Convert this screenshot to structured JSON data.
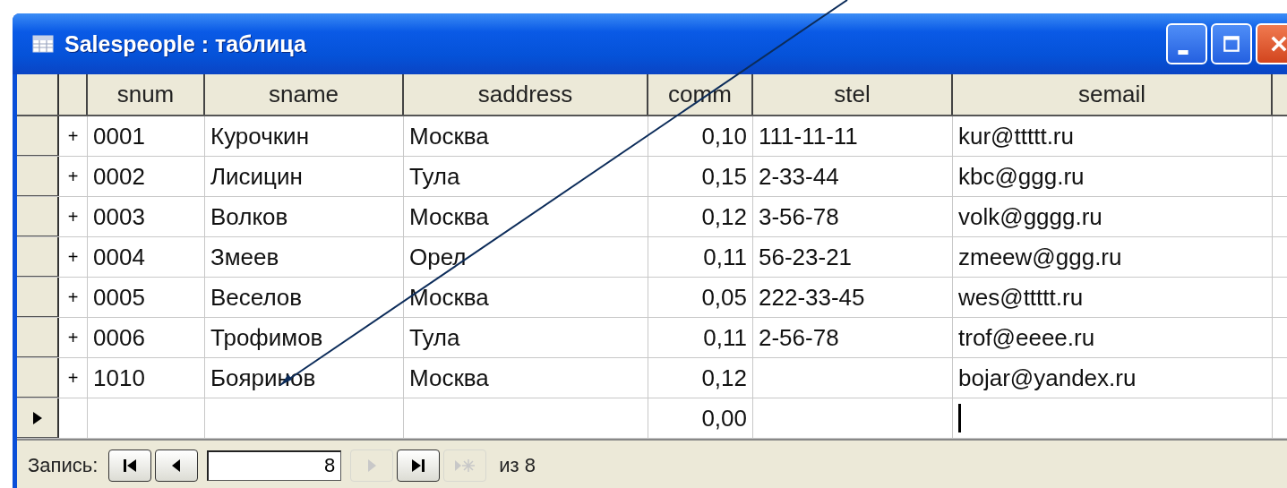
{
  "window": {
    "title": "Salespeople : таблица"
  },
  "table": {
    "columns": [
      {
        "label": "snum",
        "kind": "text"
      },
      {
        "label": "sname",
        "kind": "text"
      },
      {
        "label": "saddress",
        "kind": "text"
      },
      {
        "label": "comm",
        "kind": "number"
      },
      {
        "label": "stel",
        "kind": "text"
      },
      {
        "label": "semail",
        "kind": "text"
      }
    ],
    "rows": [
      {
        "current": false,
        "expand": "+",
        "cells": [
          "0001",
          "Курочкин",
          "Москва",
          "0,10",
          "111-11-11",
          "kur@ttttt.ru"
        ]
      },
      {
        "current": false,
        "expand": "+",
        "cells": [
          "0002",
          "Лисицин",
          "Тула",
          "0,15",
          "2-33-44",
          "kbc@ggg.ru"
        ]
      },
      {
        "current": false,
        "expand": "+",
        "cells": [
          "0003",
          "Волков",
          "Москва",
          "0,12",
          "3-56-78",
          "volk@gggg.ru"
        ]
      },
      {
        "current": false,
        "expand": "+",
        "cells": [
          "0004",
          "Змеев",
          "Орел",
          "0,11",
          "56-23-21",
          "zmeew@ggg.ru"
        ]
      },
      {
        "current": false,
        "expand": "+",
        "cells": [
          "0005",
          "Веселов",
          "Москва",
          "0,05",
          "222-33-45",
          "wes@ttttt.ru"
        ]
      },
      {
        "current": false,
        "expand": "+",
        "cells": [
          "0006",
          "Трофимов",
          "Тула",
          "0,11",
          "2-56-78",
          "trof@eeee.ru"
        ]
      },
      {
        "current": false,
        "expand": "+",
        "cells": [
          "1010",
          "Бояринов",
          "Москва",
          "0,12",
          "",
          "bojar@yandex.ru"
        ]
      },
      {
        "current": true,
        "cells": [
          "",
          "",
          "",
          "0,00",
          "",
          ""
        ]
      }
    ]
  },
  "navigator": {
    "label": "Запись:",
    "buttons": [
      {
        "kind": "first",
        "disabled": false
      },
      {
        "kind": "prev",
        "disabled": false
      }
    ],
    "record": "8",
    "buttons_after": [
      {
        "kind": "next",
        "disabled": true
      },
      {
        "kind": "last",
        "disabled": false
      },
      {
        "kind": "new",
        "disabled": true
      }
    ],
    "total": "из 8"
  }
}
